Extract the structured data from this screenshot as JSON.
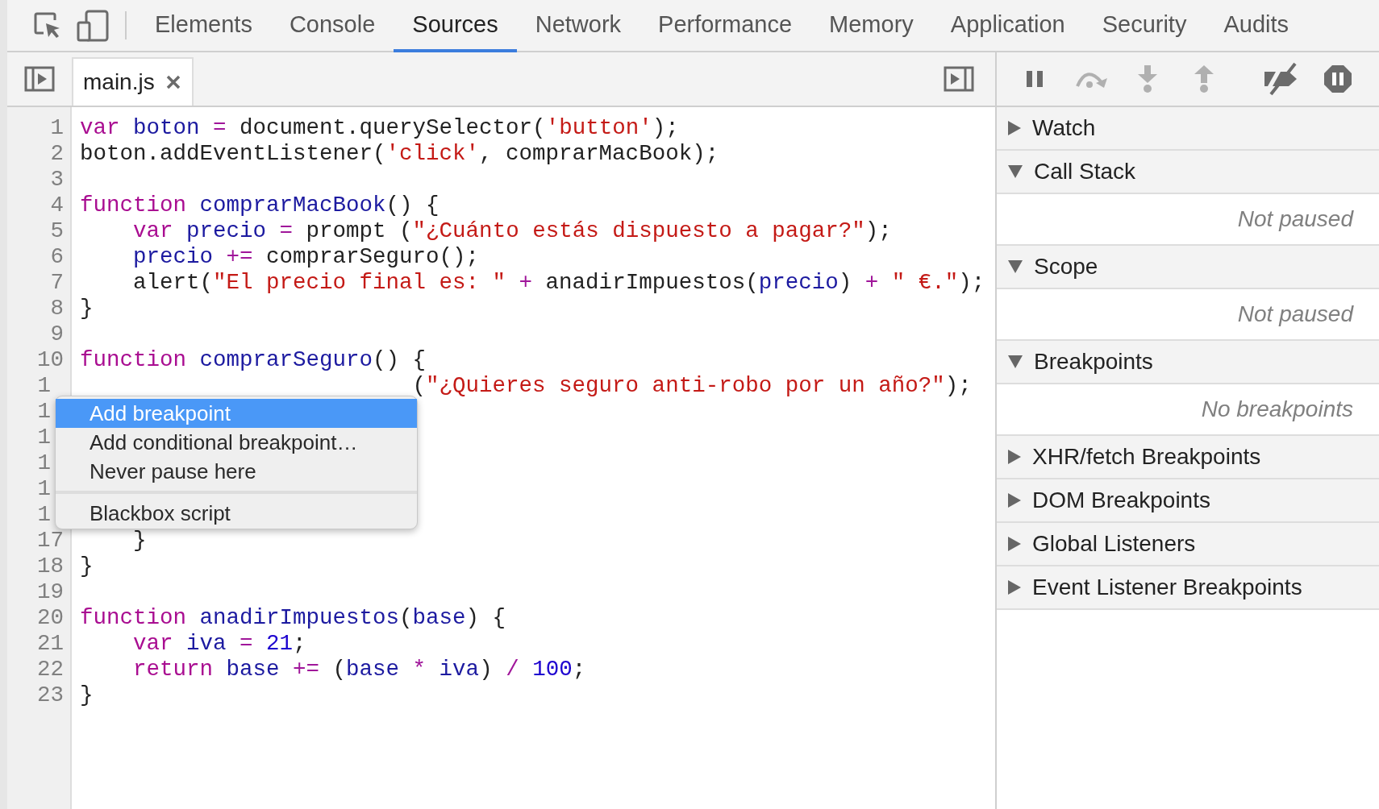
{
  "main_tabs": [
    {
      "label": "Elements",
      "selected": false
    },
    {
      "label": "Console",
      "selected": false
    },
    {
      "label": "Sources",
      "selected": true
    },
    {
      "label": "Network",
      "selected": false
    },
    {
      "label": "Performance",
      "selected": false
    },
    {
      "label": "Memory",
      "selected": false
    },
    {
      "label": "Application",
      "selected": false
    },
    {
      "label": "Security",
      "selected": false
    },
    {
      "label": "Audits",
      "selected": false
    }
  ],
  "file_tab": {
    "label": "main.js"
  },
  "debug_controls": [
    {
      "kind": "pause",
      "disabled": false
    },
    {
      "kind": "step_over",
      "disabled": true
    },
    {
      "kind": "step_into",
      "disabled": true
    },
    {
      "kind": "step_out",
      "disabled": true
    },
    {
      "kind": "deactivate",
      "disabled": false
    },
    {
      "kind": "exceptions",
      "disabled": false
    }
  ],
  "code": {
    "lines": [
      {
        "number": "1",
        "covered": false,
        "tokens": [
          {
            "kind": "kw",
            "text": "var"
          },
          {
            "kind": "var",
            "text": " boton"
          },
          {
            "kind": "op",
            "text": " ="
          },
          {
            "kind": "plain",
            "text": " document.querySelector("
          },
          {
            "kind": "str",
            "text": "'button'"
          },
          {
            "kind": "plain",
            "text": ");"
          }
        ]
      },
      {
        "number": "2",
        "covered": false,
        "tokens": [
          {
            "kind": "plain",
            "text": "boton.addEventListener("
          },
          {
            "kind": "str",
            "text": "'click'"
          },
          {
            "kind": "plain",
            "text": ", comprarMacBook);"
          }
        ]
      },
      {
        "number": "3",
        "covered": false
      },
      {
        "number": "4",
        "covered": false,
        "tokens": [
          {
            "kind": "kw",
            "text": "function"
          },
          {
            "kind": "var",
            "text": " comprarMacBook"
          },
          {
            "kind": "plain",
            "text": "() {"
          }
        ]
      },
      {
        "number": "5",
        "covered": false,
        "tokens": [
          {
            "kind": "kw",
            "text": "    var"
          },
          {
            "kind": "var",
            "text": " precio"
          },
          {
            "kind": "op",
            "text": " ="
          },
          {
            "kind": "plain",
            "text": " prompt ("
          },
          {
            "kind": "str",
            "text": "\"¿Cuánto estás dispuesto a pagar?\""
          },
          {
            "kind": "plain",
            "text": ");"
          }
        ]
      },
      {
        "number": "6",
        "covered": false,
        "tokens": [
          {
            "kind": "var",
            "text": "    precio"
          },
          {
            "kind": "op",
            "text": " +="
          },
          {
            "kind": "plain",
            "text": " comprarSeguro();"
          }
        ]
      },
      {
        "number": "7",
        "covered": false,
        "tokens": [
          {
            "kind": "plain",
            "text": "    alert("
          },
          {
            "kind": "str",
            "text": "\"El precio final es: \""
          },
          {
            "kind": "op",
            "text": " +"
          },
          {
            "kind": "plain",
            "text": " anadirImpuestos("
          },
          {
            "kind": "var",
            "text": "precio"
          },
          {
            "kind": "plain",
            "text": ")"
          },
          {
            "kind": "op",
            "text": " +"
          },
          {
            "kind": "str",
            "text": " \" €.\""
          },
          {
            "kind": "plain",
            "text": ");"
          }
        ]
      },
      {
        "number": "8",
        "covered": false,
        "tokens": [
          {
            "kind": "plain",
            "text": "}"
          }
        ]
      },
      {
        "number": "9",
        "covered": false
      },
      {
        "number": "10",
        "covered": false,
        "tokens": [
          {
            "kind": "kw",
            "text": "function"
          },
          {
            "kind": "var",
            "text": " comprarSeguro"
          },
          {
            "kind": "plain",
            "text": "() {"
          }
        ]
      },
      {
        "number": "1",
        "covered": true,
        "tokens": [
          {
            "kind": "plain",
            "text": "                         ("
          },
          {
            "kind": "str",
            "text": "\"¿Quieres seguro anti-robo por un año?\""
          },
          {
            "kind": "plain",
            "text": ");"
          }
        ]
      },
      {
        "number": "1",
        "covered": true
      },
      {
        "number": "1",
        "covered": true
      },
      {
        "number": "1",
        "covered": true
      },
      {
        "number": "1",
        "covered": true
      },
      {
        "number": "1",
        "covered": true
      },
      {
        "number": "17",
        "covered": false,
        "tokens": [
          {
            "kind": "plain",
            "text": "    }"
          }
        ]
      },
      {
        "number": "18",
        "covered": false,
        "tokens": [
          {
            "kind": "plain",
            "text": "}"
          }
        ]
      },
      {
        "number": "19",
        "covered": false
      },
      {
        "number": "20",
        "covered": false,
        "tokens": [
          {
            "kind": "kw",
            "text": "function"
          },
          {
            "kind": "var",
            "text": " anadirImpuestos"
          },
          {
            "kind": "plain",
            "text": "("
          },
          {
            "kind": "var",
            "text": "base"
          },
          {
            "kind": "plain",
            "text": ") {"
          }
        ]
      },
      {
        "number": "21",
        "covered": false,
        "tokens": [
          {
            "kind": "kw",
            "text": "    var"
          },
          {
            "kind": "var",
            "text": " iva"
          },
          {
            "kind": "op",
            "text": " ="
          },
          {
            "kind": "num",
            "text": " 21"
          },
          {
            "kind": "plain",
            "text": ";"
          }
        ]
      },
      {
        "number": "22",
        "covered": false,
        "tokens": [
          {
            "kind": "kw",
            "text": "    return"
          },
          {
            "kind": "var",
            "text": " base"
          },
          {
            "kind": "op",
            "text": " +="
          },
          {
            "kind": "plain",
            "text": " ("
          },
          {
            "kind": "var",
            "text": "base"
          },
          {
            "kind": "op",
            "text": " *"
          },
          {
            "kind": "var",
            "text": " iva"
          },
          {
            "kind": "plain",
            "text": ")"
          },
          {
            "kind": "op",
            "text": " /"
          },
          {
            "kind": "num",
            "text": " 100"
          },
          {
            "kind": "plain",
            "text": ";"
          }
        ]
      },
      {
        "number": "23",
        "covered": false,
        "tokens": [
          {
            "kind": "plain",
            "text": "}"
          }
        ]
      }
    ]
  },
  "context_menu": {
    "groups": [
      [
        {
          "label": "Add breakpoint",
          "selected": true
        },
        {
          "label": "Add conditional breakpoint…",
          "selected": false
        },
        {
          "label": "Never pause here",
          "selected": false
        }
      ],
      [
        {
          "label": "Blackbox script",
          "selected": false
        }
      ]
    ]
  },
  "sidebar": {
    "sections": [
      {
        "title": "Watch",
        "expanded": false
      },
      {
        "title": "Call Stack",
        "expanded": true,
        "message": "Not paused"
      },
      {
        "title": "Scope",
        "expanded": true,
        "message": "Not paused"
      },
      {
        "title": "Breakpoints",
        "expanded": true,
        "message": "No breakpoints"
      },
      {
        "title": "XHR/fetch Breakpoints",
        "expanded": false
      },
      {
        "title": "DOM Breakpoints",
        "expanded": false
      },
      {
        "title": "Global Listeners",
        "expanded": false
      },
      {
        "title": "Event Listener Breakpoints",
        "expanded": false
      }
    ]
  }
}
